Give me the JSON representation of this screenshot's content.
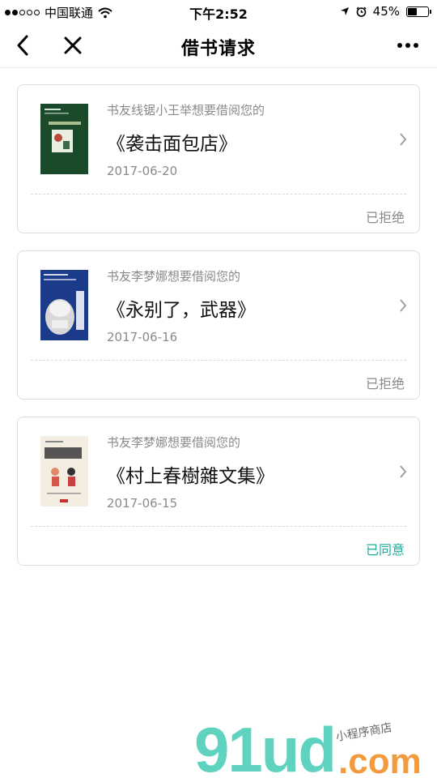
{
  "status_bar": {
    "carrier": "中国联通",
    "time": "下午2:52",
    "battery": "45%",
    "battery_level": 0.45
  },
  "nav": {
    "title": "借书请求",
    "icons": [
      "back-arrow-icon",
      "close-icon",
      "more-dots-icon"
    ]
  },
  "requests": [
    {
      "requester_text": "书友线锯小王举想要借阅您的",
      "book_title": "《袭击面包店》",
      "date": "2017-06-20",
      "status": "已拒绝",
      "cover_color": "#1a4a2a"
    },
    {
      "requester_text": "书友李梦娜想要借阅您的",
      "book_title": "《永别了，武器》",
      "date": "2017-06-16",
      "status": "已拒绝",
      "cover_color": "#1c3a8a"
    },
    {
      "requester_text": "书友李梦娜想要借阅您的",
      "book_title": "《村上春樹雜文集》",
      "date": "2017-06-15",
      "status": "已同意",
      "cover_color": "#f3ede2"
    }
  ],
  "watermark": {
    "brand": "91ud",
    "domain": ".com",
    "tagline": "小程序商店",
    "colors": {
      "teal": "#5fd2c0",
      "orange": "#f39a3c"
    }
  }
}
